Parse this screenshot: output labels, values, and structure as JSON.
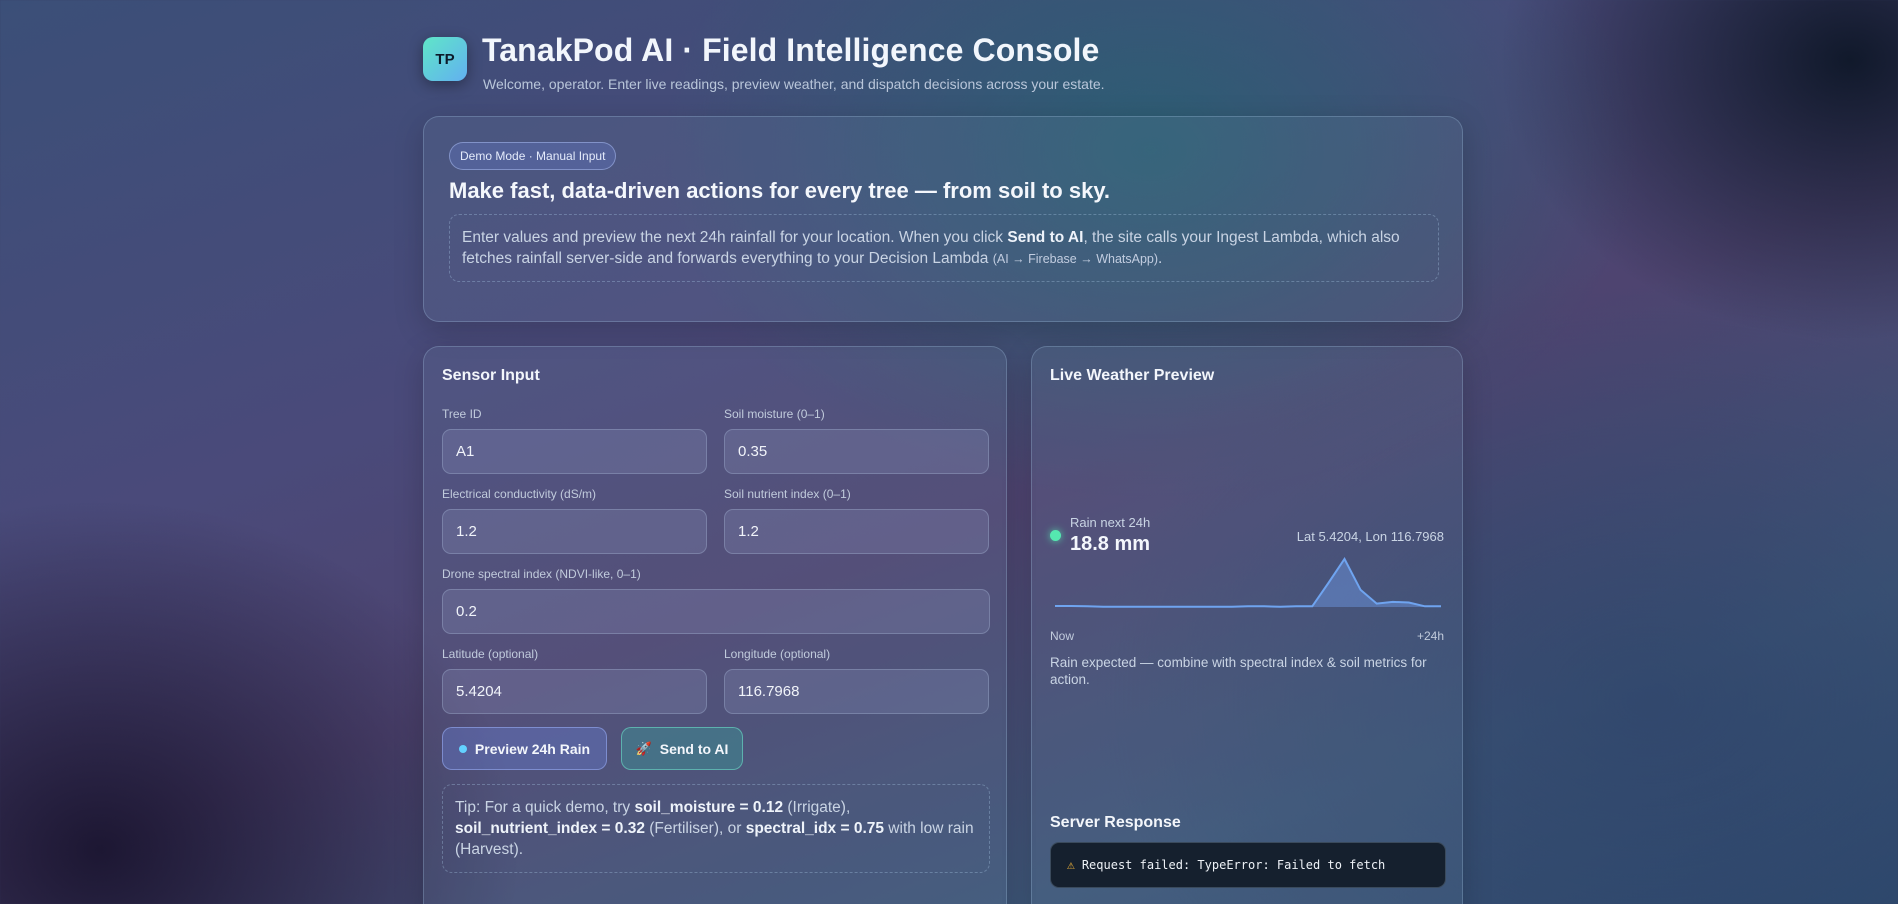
{
  "header": {
    "logo_text": "TP",
    "title": "TanakPod AI · Field Intelligence Console",
    "subtitle": "Welcome, operator. Enter live readings, preview weather, and dispatch decisions across your estate."
  },
  "hero": {
    "badge": "Demo Mode · Manual Input",
    "heading": "Make fast, data-driven actions for every tree — from soil to sky.",
    "note_part1": "Enter values and preview the next 24h rainfall for your location. When you click ",
    "note_bold": "Send to AI",
    "note_part2": ", the site calls your Ingest Lambda, which also fetches rainfall server-side and forwards everything to your Decision Lambda ",
    "note_small": "(AI → Firebase → WhatsApp)",
    "note_end": "."
  },
  "sensor": {
    "title": "Sensor Input",
    "fields": {
      "tree_id": {
        "label": "Tree ID",
        "value": "A1"
      },
      "soil_moisture": {
        "label": "Soil moisture (0–1)",
        "value": "0.35"
      },
      "ec": {
        "label": "Electrical conductivity (dS/m)",
        "value": "1.2"
      },
      "nutrient": {
        "label": "Soil nutrient index (0–1)",
        "value": "1.2"
      },
      "spectral": {
        "label": "Drone spectral index (NDVI-like, 0–1)",
        "value": "0.2"
      },
      "latitude": {
        "label": "Latitude (optional)",
        "value": "5.4204"
      },
      "longitude": {
        "label": "Longitude (optional)",
        "value": "116.7968"
      }
    },
    "preview_button": "Preview 24h Rain",
    "send_button": "Send to AI",
    "tip": {
      "t1": "Tip: For a quick demo, try ",
      "b1": "soil_moisture = 0.12",
      "t2": " (Irrigate), ",
      "b2": "soil_nutrient_index = 0.32",
      "t3": " (Fertiliser), or ",
      "b3": "spectral_idx = 0.75",
      "t4": " with low rain (Harvest)."
    }
  },
  "weather": {
    "title": "Live Weather Preview",
    "rain_label": "Rain next 24h",
    "rain_value": "18.8 mm",
    "latlon": "Lat 5.4204, Lon 116.7968",
    "axis_start": "Now",
    "axis_end": "+24h",
    "message": "Rain expected — combine with spectral index & soil metrics for action.",
    "hourly_mm": [
      0.3,
      0.3,
      0.2,
      0.1,
      0.1,
      0.1,
      0.1,
      0.1,
      0.1,
      0.1,
      0.1,
      0.1,
      0.2,
      0.2,
      0.1,
      0.2,
      0.2,
      7.0,
      14.0,
      5.0,
      1.0,
      1.5,
      1.3,
      0.2,
      0.2
    ],
    "colors": {
      "line": "#6fa4f0",
      "fill": "#6f9be8",
      "dot": "#55e8b0"
    }
  },
  "server": {
    "title": "Server Response",
    "message": "Request failed: TypeError: Failed to fetch",
    "icon": "warning-icon"
  }
}
